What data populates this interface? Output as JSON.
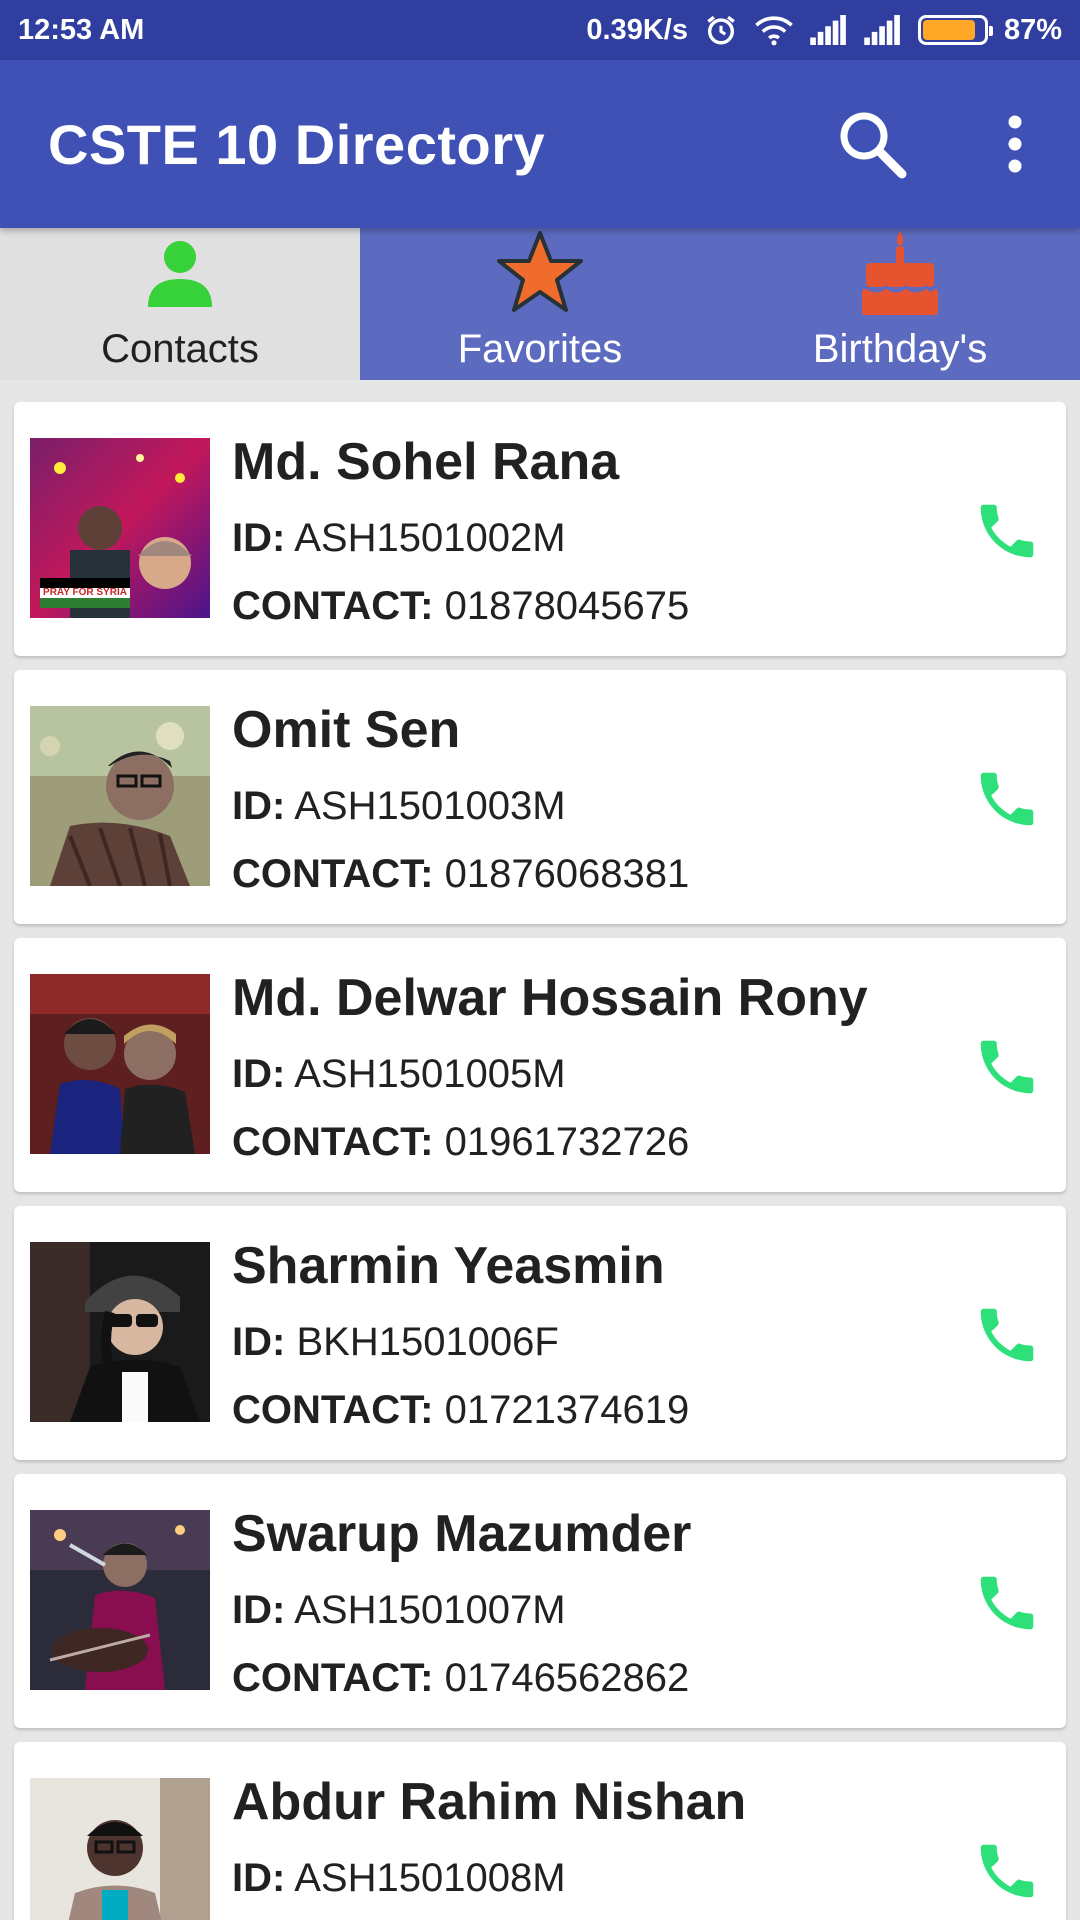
{
  "status_bar": {
    "time": "12:53 AM",
    "speed": "0.39K/s",
    "battery_percent_text": "87%",
    "battery_level": 0.87,
    "icons": [
      "alarm-icon",
      "wifi-icon",
      "signal-icon",
      "signal-icon",
      "battery-icon"
    ]
  },
  "toolbar": {
    "title": "CSTE 10 Directory",
    "icons": [
      "search-icon",
      "more-vert-icon"
    ]
  },
  "tabs": [
    {
      "label": "Contacts",
      "icon": "person-icon",
      "active": true
    },
    {
      "label": "Favorites",
      "icon": "star-icon",
      "active": false
    },
    {
      "label": "Birthday's",
      "icon": "cake-icon",
      "active": false
    }
  ],
  "labels": {
    "id": "ID:",
    "contact": "CONTACT:"
  },
  "contacts": [
    {
      "name": "Md. Sohel Rana",
      "id": "ASH1501002M",
      "contact": "01878045675",
      "photo_caption": "PRAY FOR SYRIA"
    },
    {
      "name": "Omit Sen",
      "id": "ASH1501003M",
      "contact": "01876068381"
    },
    {
      "name": "Md. Delwar Hossain Rony",
      "id": "ASH1501005M",
      "contact": "01961732726"
    },
    {
      "name": "Sharmin Yeasmin",
      "id": "BKH1501006F",
      "contact": "01721374619"
    },
    {
      "name": "Swarup Mazumder",
      "id": "ASH1501007M",
      "contact": "01746562862"
    },
    {
      "name": "Abdur Rahim Nishan",
      "id": "ASH1501008M",
      "contact": ""
    }
  ],
  "colors": {
    "status_bar": "#303f9f",
    "toolbar": "#3f51b5",
    "tab_bar": "#5c6bc0",
    "active_tab": "#e0e0e0",
    "person_icon": "#37d23a",
    "star_icon": "#ef6c2c",
    "cake_icon": "#e6532f",
    "call_icon": "#2ee07a"
  }
}
